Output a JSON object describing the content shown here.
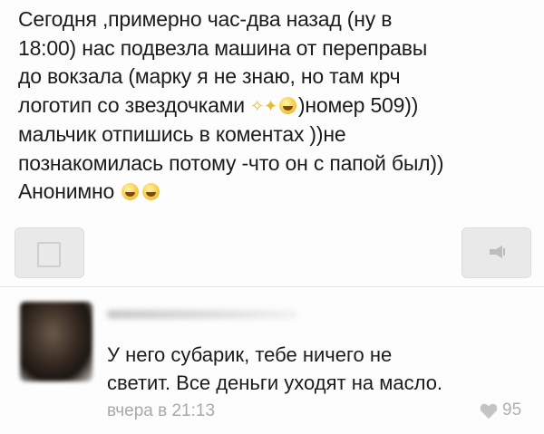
{
  "post": {
    "lines": [
      "Сегодня ,примерно час-два  назад (ну в",
      "18:00) нас подвезла машина от переправы",
      "до вокзала  (марку я не знаю, но там крч",
      "логотип со звездочками",
      ")номер 509))",
      "мальчик отпишись в коментах ))не",
      "познакомилась потому -что он с папой был))",
      "Анонимно"
    ],
    "emoji_icons": [
      "sparkles-icon",
      "laughing-emoji-icon",
      "grinning-emoji-icon",
      "smiling-emoji-icon"
    ]
  },
  "actions": {
    "left_icon": "square-icon",
    "right_icon": "megaphone-icon"
  },
  "comment": {
    "lines": [
      "У него субарик, тебе ничего не",
      "светит. Все деньги уходят на масло."
    ],
    "time": "вчера в 21:13",
    "likes": "95"
  },
  "colors": {
    "text": "#1c1c1c",
    "meta": "#a9a9a9",
    "button_bg": "#e9e9e9"
  }
}
